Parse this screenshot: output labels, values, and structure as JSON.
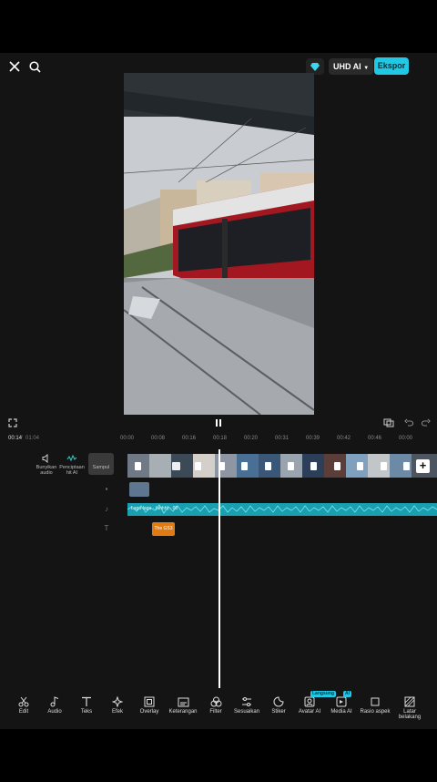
{
  "topbar": {
    "uhd_label": "UHD AI",
    "export_label": "Ekspor"
  },
  "timeline": {
    "current_time": "00:14",
    "total_time": "01:04",
    "ruler_ticks": [
      "00:00",
      "00:08",
      "00:16",
      "00:18",
      "00:20",
      "00:31",
      "00:39",
      "00:42",
      "00:46",
      "00:00"
    ],
    "side_buttons": {
      "audio_label": "Bunyikan audio",
      "ai_label": "Penciptaan hit AI",
      "cover_label": "Sampul"
    },
    "audio_clip_label": "Lagu-lagu · (ahhh) · 00",
    "text_clip_label": "The GS3"
  },
  "tools": [
    {
      "icon": "scissors-icon",
      "label": "Edit"
    },
    {
      "icon": "music-note-icon",
      "label": "Audio"
    },
    {
      "icon": "text-icon",
      "label": "Teks"
    },
    {
      "icon": "sparkle-icon",
      "label": "Efek"
    },
    {
      "icon": "overlay-icon",
      "label": "Overlay"
    },
    {
      "icon": "caption-icon",
      "label": "Keterangan"
    },
    {
      "icon": "filter-icon",
      "label": "Filter"
    },
    {
      "icon": "adjust-icon",
      "label": "Sesuaikan"
    },
    {
      "icon": "sticker-icon",
      "label": "Stiker"
    },
    {
      "icon": "avatar-icon",
      "label": "Avatar AI",
      "badge": "Langsung"
    },
    {
      "icon": "media-ai-icon",
      "label": "Media AI",
      "badge": "AI"
    },
    {
      "icon": "aspect-ratio-icon",
      "label": "Rasio aspek"
    },
    {
      "icon": "background-icon",
      "label": "Latar belakang"
    }
  ],
  "colors": {
    "accent": "#1fc9e6",
    "text_clip": "#e07b14",
    "audio_track": "#1a9fb0"
  }
}
